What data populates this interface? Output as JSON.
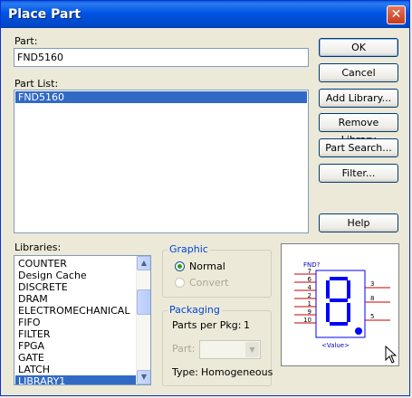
{
  "window": {
    "title": "Place Part"
  },
  "part": {
    "label": "Part:",
    "value": "FND5160"
  },
  "part_list": {
    "label": "Part List:",
    "items": [
      "FND5160"
    ],
    "selected": 0
  },
  "buttons": {
    "ok": "OK",
    "cancel": "Cancel",
    "add_library": "Add Library...",
    "remove_library": "Remove Library",
    "part_search": "Part Search...",
    "filter": "Filter...",
    "help": "Help"
  },
  "libraries": {
    "label": "Libraries:",
    "items": [
      "COUNTER",
      "Design Cache",
      "DISCRETE",
      "DRAM",
      "ELECTROMECHANICAL",
      "FIFO",
      "FILTER",
      "FPGA",
      "GATE",
      "LATCH",
      "LIBRARY1"
    ],
    "selected": 10
  },
  "graphic": {
    "title": "Graphic",
    "normal": "Normal",
    "convert": "Convert",
    "selected": "Normal"
  },
  "packaging": {
    "title": "Packaging",
    "parts_per_pkg_label": "Parts per Pkg:",
    "parts_per_pkg_value": "1",
    "part_label": "Part:",
    "type_label": "Type:",
    "type_value": "Homogeneous"
  },
  "preview": {
    "ref": "FND?",
    "value": "<Value>",
    "left_pins": [
      "7",
      "6",
      "4",
      "2",
      "1",
      "9",
      "10"
    ],
    "right_pins": [
      "3",
      "8",
      "5"
    ]
  },
  "colors": {
    "title_bar": "#0054e3",
    "selection": "#316ac5",
    "group_title": "#0046d5",
    "symbol": "#0000ff",
    "pin": "#c00000"
  }
}
